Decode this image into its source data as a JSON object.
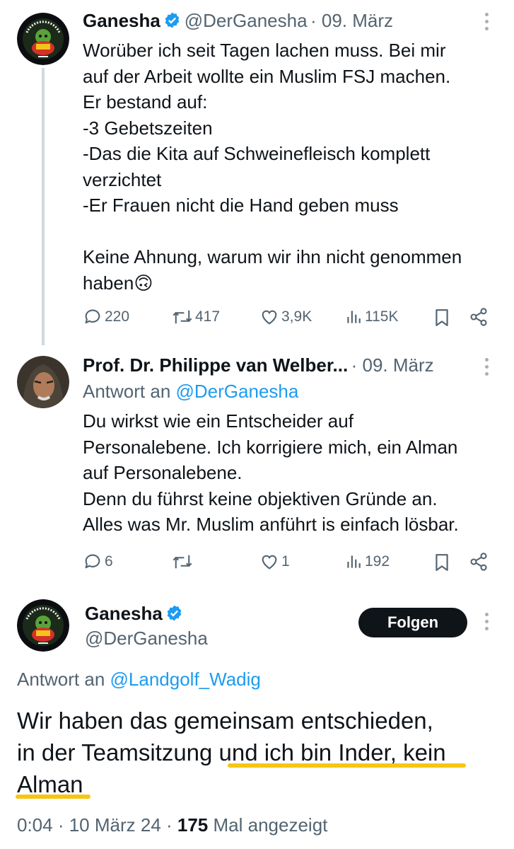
{
  "tweet1": {
    "name": "Ganesha",
    "handle": "@DerGanesha",
    "date": "· 09. März",
    "text": "Worüber ich seit Tagen lachen muss. Bei mir\nauf der Arbeit wollte ein Muslim FSJ machen.\nEr bestand auf:\n-3 Gebetszeiten\n-Das die Kita auf Schweinefleisch komplett\nverzichtet\n-Er Frauen nicht die Hand geben muss\n\nKeine Ahnung, warum wir ihn nicht genommen\nhaben",
    "emoji": "🙃",
    "replies": "220",
    "retweets": "417",
    "likes": "3,9K",
    "views": "115K"
  },
  "tweet2": {
    "name": "Prof. Dr. Philippe van Welber...",
    "date": "· 09. März",
    "reply_prefix": "Antwort an ",
    "reply_handle": "@DerGanesha",
    "text": "Du wirkst wie ein Entscheider auf\nPersonalebene. Ich korrigiere mich, ein Alman\nauf Personalebene.\nDenn du führst keine objektiven Gründe an.\nAlles was Mr. Muslim anführt is einfach lösbar.",
    "replies": "6",
    "retweets": "",
    "likes": "1",
    "views": "192"
  },
  "tweet3": {
    "name": "Ganesha",
    "handle": "@DerGanesha",
    "follow_label": "Folgen",
    "reply_prefix": "Antwort an ",
    "reply_handle": "@Landgolf_Wadig",
    "line1": "Wir haben das gemeinsam entschieden,",
    "line2a": "in der Teamsitzung ",
    "line2b": "und ich bin Inder, kein",
    "line3": "Alman",
    "time": "0:04 · 10 März 24 · ",
    "view_count": "175",
    "view_suffix": " Mal angezeigt"
  },
  "colors": {
    "verified": "#1d9bf0",
    "link": "#1d9bf0",
    "underline": "#f6c616",
    "muted": "#536471"
  }
}
